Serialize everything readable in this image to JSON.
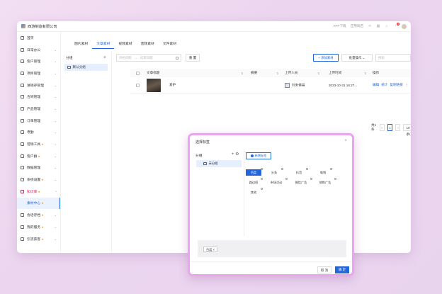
{
  "header": {
    "company": "西游制造有限公司",
    "app_download": "APP下载",
    "apply_ticket": "应用商店",
    "notif_count": "8"
  },
  "sidebar": {
    "items": [
      {
        "label": "首页",
        "chev": "",
        "vip": ""
      },
      {
        "label": "日常办公",
        "chev": "⌄",
        "vip": ""
      },
      {
        "label": "客户管理",
        "chev": "⌄",
        "vip": ""
      },
      {
        "label": "项目管理",
        "chev": "⌄",
        "vip": ""
      },
      {
        "label": "进销存管理",
        "chev": "⌄",
        "vip": ""
      },
      {
        "label": "合同管理",
        "chev": "⌄",
        "vip": ""
      },
      {
        "label": "产品管理",
        "chev": "⌄",
        "vip": ""
      },
      {
        "label": "订单管理",
        "chev": "⌄",
        "vip": ""
      },
      {
        "label": "考勤",
        "chev": "⌄",
        "vip": ""
      },
      {
        "label": "营销工具",
        "chev": "⌄",
        "vip": "★"
      },
      {
        "label": "客户群",
        "chev": "⌄",
        "vip": "★"
      },
      {
        "label": "数据管理",
        "chev": "⌄",
        "vip": ""
      },
      {
        "label": "系统设置",
        "chev": "⌄",
        "vip": "★"
      },
      {
        "label": "知识库",
        "chev": "^",
        "vip": "★"
      },
      {
        "label": "素材中心",
        "chev": "",
        "vip": "★"
      },
      {
        "label": "会话存档",
        "chev": "⌄",
        "vip": "★"
      },
      {
        "label": "我的服务",
        "chev": "⌄",
        "vip": "★"
      },
      {
        "label": "引流获客",
        "chev": "⌄",
        "vip": "★"
      }
    ]
  },
  "tabs": [
    "图片素材",
    "文章素材",
    "视频素材",
    "音频素材",
    "文件素材"
  ],
  "group_panel": {
    "title": "分组",
    "item": "默认分组"
  },
  "toolbar": {
    "start_placeholder": "开始日期",
    "arrow": "→",
    "end_placeholder": "结束日期",
    "reset": "重 置",
    "add": "+ 添加素材",
    "batch": "批量操作 ⌄",
    "search_placeholder": "搜索"
  },
  "table": {
    "headers": [
      "文章标题",
      "摘要",
      "上传人员",
      "上传时间",
      "操作"
    ],
    "rows": [
      {
        "title": "爱护",
        "summary": "",
        "uploader": "刘未佛福",
        "time": "2023-10-31 16:27...",
        "ops": [
          "编辑",
          "统计",
          "复制链接"
        ]
      }
    ]
  },
  "pagination": {
    "total": "共1条",
    "prev": "<",
    "current": "1",
    "next": ">",
    "size": "10 条/页"
  },
  "dialog": {
    "title": "选择标签",
    "close": "×",
    "group_label": "分组",
    "group_icons": "+ ⚙",
    "group_item": "未分组",
    "new_tag": "新增标签",
    "tags": [
      "百度",
      "头条",
      "抖音",
      "电销",
      "路边招",
      "市场活动",
      "微信广告",
      "地铁广告",
      "其他"
    ],
    "selected_chip": "百度 ×",
    "cancel": "取 消",
    "ok": "确 定"
  },
  "colors": {
    "primary": "#2266dd",
    "active_menu": "#d0245b",
    "dialog_border": "#e9a6ee"
  }
}
